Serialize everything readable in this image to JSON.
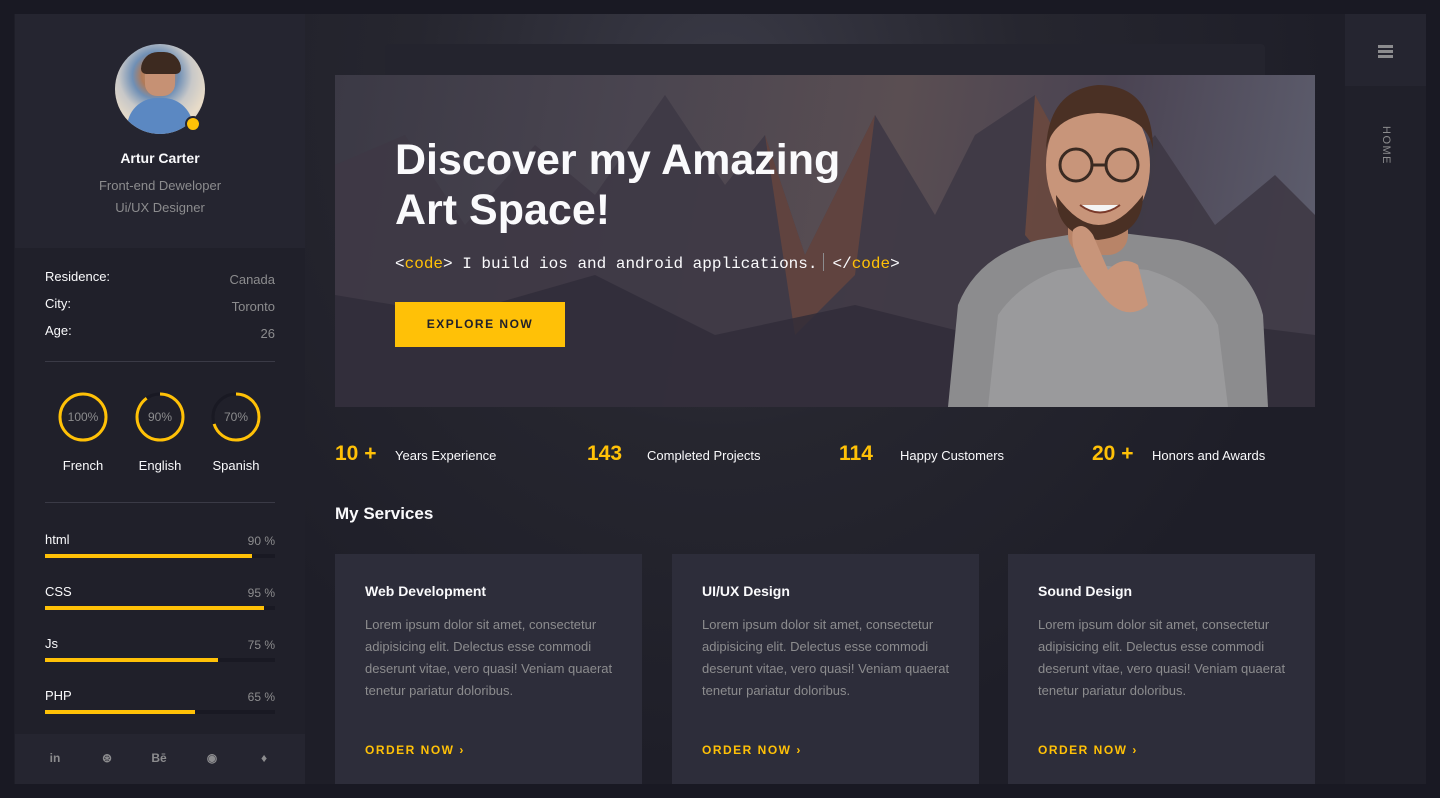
{
  "profile": {
    "name": "Artur Carter",
    "role_line1": "Front-end Deweloper",
    "role_line2": "Ui/UX Designer"
  },
  "info": [
    {
      "key": "Residence:",
      "value": "Canada"
    },
    {
      "key": "City:",
      "value": "Toronto"
    },
    {
      "key": "Age:",
      "value": "26"
    }
  ],
  "languages": [
    {
      "name": "French",
      "percent_label": "100%",
      "percent": 100
    },
    {
      "name": "English",
      "percent_label": "90%",
      "percent": 90
    },
    {
      "name": "Spanish",
      "percent_label": "70%",
      "percent": 70
    }
  ],
  "skills": [
    {
      "name": "html",
      "percent_label": "90 %",
      "percent": 90
    },
    {
      "name": "CSS",
      "percent_label": "95 %",
      "percent": 95
    },
    {
      "name": "Js",
      "percent_label": "75 %",
      "percent": 75
    },
    {
      "name": "PHP",
      "percent_label": "65 %",
      "percent": 65
    }
  ],
  "social": [
    "in",
    "⊛",
    "Bē",
    "◉",
    "♦"
  ],
  "social_icons": [
    "linkedin-icon",
    "dribbble-icon",
    "behance-icon",
    "github-icon",
    "twitter-icon"
  ],
  "nav": {
    "home": "HOME",
    "menu_icon": "hamburger-menu-icon"
  },
  "hero": {
    "title_line1": "Discover my Amazing",
    "title_line2": "Art Space!",
    "code_open_lt": "<",
    "code_open_tag": "code",
    "code_open_gt": ">",
    "code_text": " I build ios and android applications.",
    "code_close_lt": "</",
    "code_close_tag": "code",
    "code_close_gt": ">",
    "button": "EXPLORE NOW"
  },
  "counters": [
    {
      "number": "10 +",
      "label": "Years Experience"
    },
    {
      "number": "143",
      "label": "Completed Projects"
    },
    {
      "number": "114",
      "label": "Happy Customers"
    },
    {
      "number": "20 +",
      "label": "Honors and Awards"
    }
  ],
  "services": {
    "title": "My Services",
    "cards": [
      {
        "title": "Web Development",
        "desc": "Lorem ipsum dolor sit amet, consectetur adipisicing elit. Delectus esse commodi deserunt vitae, vero quasi! Veniam quaerat tenetur pariatur doloribus.",
        "link": "ORDER NOW ›"
      },
      {
        "title": "UI/UX Design",
        "desc": "Lorem ipsum dolor sit amet, consectetur adipisicing elit. Delectus esse commodi deserunt vitae, vero quasi! Veniam quaerat tenetur pariatur doloribus.",
        "link": "ORDER NOW ›"
      },
      {
        "title": "Sound Design",
        "desc": "Lorem ipsum dolor sit amet, consectetur adipisicing elit. Delectus esse commodi deserunt vitae, vero quasi! Veniam quaerat tenetur pariatur doloribus.",
        "link": "ORDER NOW ›"
      }
    ]
  },
  "colors": {
    "accent": "#ffc107",
    "bg": "#1e1e28",
    "panel": "#252530",
    "card": "#2d2d3a",
    "text": "#fafafc",
    "muted": "#8c8c8e"
  }
}
